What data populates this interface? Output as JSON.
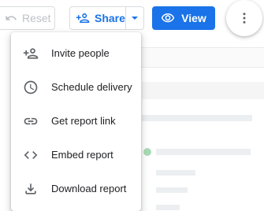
{
  "toolbar": {
    "reset_label": "Reset",
    "share_label": "Share",
    "view_label": "View"
  },
  "menu": {
    "items": [
      {
        "label": "Invite people",
        "icon": "person-add-icon"
      },
      {
        "label": "Schedule delivery",
        "icon": "clock-icon"
      },
      {
        "label": "Get report link",
        "icon": "link-icon"
      },
      {
        "label": "Embed report",
        "icon": "code-icon"
      },
      {
        "label": "Download report",
        "icon": "download-icon"
      }
    ]
  },
  "colors": {
    "accent": "#1a73e8",
    "disabled": "#bdc1c6",
    "icon": "#5f6368"
  }
}
